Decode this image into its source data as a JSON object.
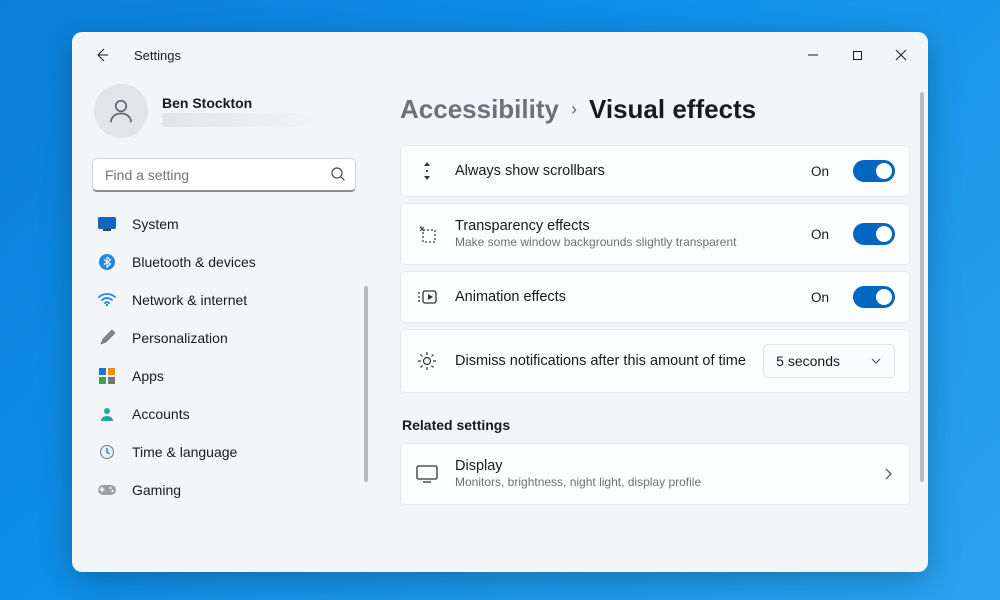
{
  "window": {
    "title": "Settings"
  },
  "user": {
    "name": "Ben Stockton"
  },
  "search": {
    "placeholder": "Find a setting"
  },
  "nav": {
    "items": [
      {
        "label": "System"
      },
      {
        "label": "Bluetooth & devices"
      },
      {
        "label": "Network & internet"
      },
      {
        "label": "Personalization"
      },
      {
        "label": "Apps"
      },
      {
        "label": "Accounts"
      },
      {
        "label": "Time & language"
      },
      {
        "label": "Gaming"
      }
    ]
  },
  "breadcrumb": {
    "parent": "Accessibility",
    "current": "Visual effects"
  },
  "settings": {
    "scrollbars": {
      "title": "Always show scrollbars",
      "state": "On"
    },
    "transparency": {
      "title": "Transparency effects",
      "sub": "Make some window backgrounds slightly transparent",
      "state": "On"
    },
    "animation": {
      "title": "Animation effects",
      "state": "On"
    },
    "dismiss": {
      "title": "Dismiss notifications after this amount of time",
      "value": "5 seconds"
    }
  },
  "related": {
    "heading": "Related settings",
    "display": {
      "title": "Display",
      "sub": "Monitors, brightness, night light, display profile"
    }
  },
  "colors": {
    "accent": "#0067c0"
  }
}
